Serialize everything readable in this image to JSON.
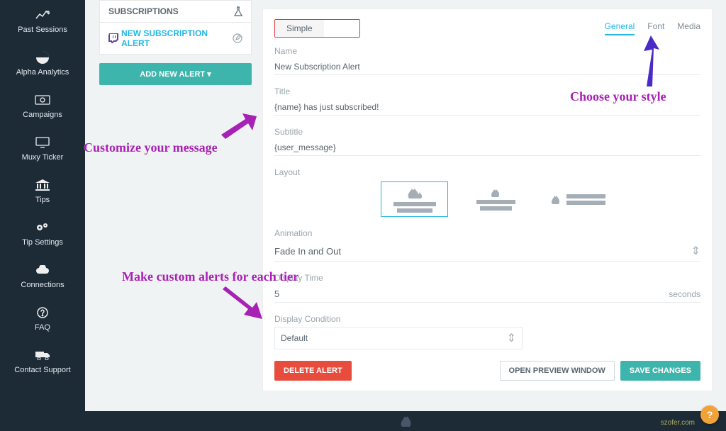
{
  "sidebar": {
    "items": [
      {
        "label": "Past Sessions",
        "icon": "chart-line-icon"
      },
      {
        "label": "Alpha Analytics",
        "icon": "pie-chart-icon"
      },
      {
        "label": "Campaigns",
        "icon": "money-icon"
      },
      {
        "label": "Muxy Ticker",
        "icon": "monitor-icon"
      },
      {
        "label": "Tips",
        "icon": "bank-icon"
      },
      {
        "label": "Tip Settings",
        "icon": "gears-icon"
      },
      {
        "label": "Connections",
        "icon": "cloud-icon"
      },
      {
        "label": "FAQ",
        "icon": "question-icon"
      },
      {
        "label": "Contact Support",
        "icon": "truck-icon"
      }
    ]
  },
  "sublist": {
    "header": "SUBSCRIPTIONS",
    "alert_label": "NEW SUBSCRIPTION ALERT",
    "add_button": "ADD NEW ALERT"
  },
  "main": {
    "toggle": {
      "simple": "Simple",
      "advanced": ""
    },
    "tabs": {
      "general": "General",
      "font": "Font",
      "media": "Media"
    },
    "labels": {
      "name": "Name",
      "title": "Title",
      "subtitle": "Subtitle",
      "layout": "Layout",
      "animation": "Animation",
      "display_time": "Display Time",
      "display_condition": "Display Condition"
    },
    "values": {
      "name": "New Subscription Alert",
      "title": "{name} has just subscribed!",
      "subtitle": "{user_message}",
      "animation": "Fade In and Out",
      "display_time": "5",
      "display_time_unit": "seconds",
      "display_condition": "Default"
    },
    "buttons": {
      "delete": "DELETE ALERT",
      "preview": "OPEN PREVIEW WINDOW",
      "save": "SAVE CHANGES"
    }
  },
  "annotations": {
    "a1": "Customize your message",
    "a2": "Choose your style",
    "a3": "Make custom alerts for each tier"
  },
  "footer": {
    "credit": "szofer.com"
  }
}
